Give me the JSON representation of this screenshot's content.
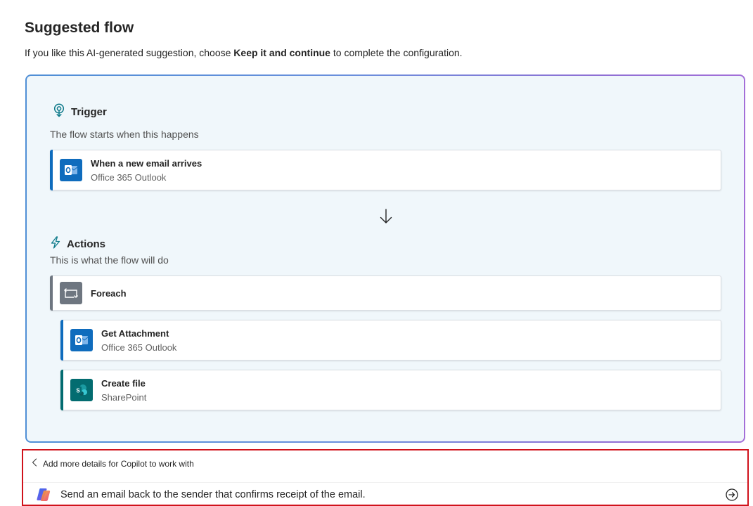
{
  "page": {
    "title": "Suggested flow",
    "intro_before": "If you like this AI-generated suggestion, choose ",
    "intro_bold": "Keep it and continue",
    "intro_after": " to complete the configuration."
  },
  "trigger_section": {
    "heading": "Trigger",
    "subtitle": "The flow starts when this happens",
    "icon": "trigger-bulb-icon",
    "steps": [
      {
        "title": "When a new email arrives",
        "connector": "Office 365 Outlook",
        "icon": "outlook-icon",
        "accent_color": "#0f6cbd",
        "icon_bg": "#0f6cbd"
      }
    ]
  },
  "actions_section": {
    "heading": "Actions",
    "subtitle": "This is what the flow will do",
    "icon": "lightning-icon",
    "steps": [
      {
        "title": "Foreach",
        "connector": "",
        "icon": "loop-icon",
        "accent_color": "#6e7680",
        "icon_bg": "#6e7680"
      },
      {
        "title": "Get Attachment",
        "connector": "Office 365 Outlook",
        "icon": "outlook-icon",
        "accent_color": "#0f6cbd",
        "icon_bg": "#0f6cbd"
      },
      {
        "title": "Create file",
        "connector": "SharePoint",
        "icon": "sharepoint-icon",
        "accent_color": "#036c70",
        "icon_bg": "#036c70"
      }
    ]
  },
  "copilot": {
    "back_label": "Add more details for Copilot to work with",
    "prompt_value": "Send an email back to the sender that confirms receipt of the email.",
    "send_icon": "send-arrow-icon",
    "highlight_color": "#d0121b"
  },
  "colors": {
    "card_bg": "#f0f7fb",
    "card_border_start": "#4f8fd6",
    "card_border_end": "#a36fd8",
    "accent_teal": "#0e7a8a"
  }
}
